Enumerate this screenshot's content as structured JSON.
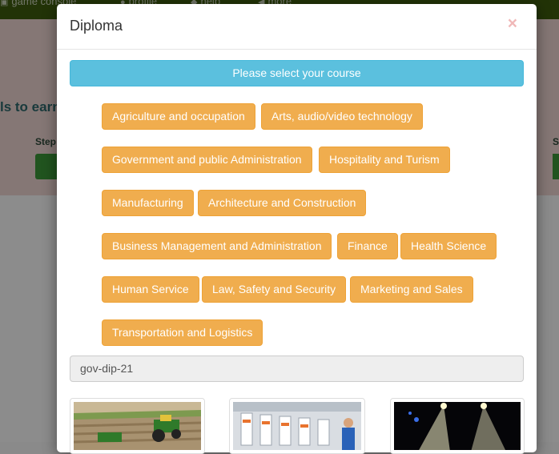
{
  "background": {
    "nav_items": [
      {
        "icon": "game-console-icon",
        "glyph": "▣",
        "label": "game console"
      },
      {
        "icon": "profile-icon",
        "glyph": "●",
        "label": "profile"
      },
      {
        "icon": "help-icon",
        "glyph": "◆",
        "label": "help"
      },
      {
        "icon": "more-icon",
        "glyph": "◀",
        "label": "more"
      }
    ],
    "heading_fragment": "ls to earn",
    "step_label": "Step",
    "step_label_right": "S"
  },
  "modal": {
    "title": "Diploma",
    "close_symbol": "×",
    "banner": "Please select your course",
    "courses": [
      "Agriculture and occupation",
      "Arts, audio/video technology",
      "Government and public Administration",
      "Hospitality and Turism",
      "Manufacturing",
      "Architecture and Construction",
      "Business Management and Administration",
      "Finance",
      "Health Science",
      "Human Service",
      "Law, Safety and Security",
      "Marketing and Sales",
      "Transportation and Logistics"
    ],
    "code_value": "gov-dip-21",
    "thumbnails": [
      "tractor-field-image",
      "factory-worker-image",
      "stage-lights-image"
    ]
  },
  "colors": {
    "banner": "#5bc0de",
    "course_button": "#f0ad4e",
    "nav": "#3f5e0e"
  }
}
